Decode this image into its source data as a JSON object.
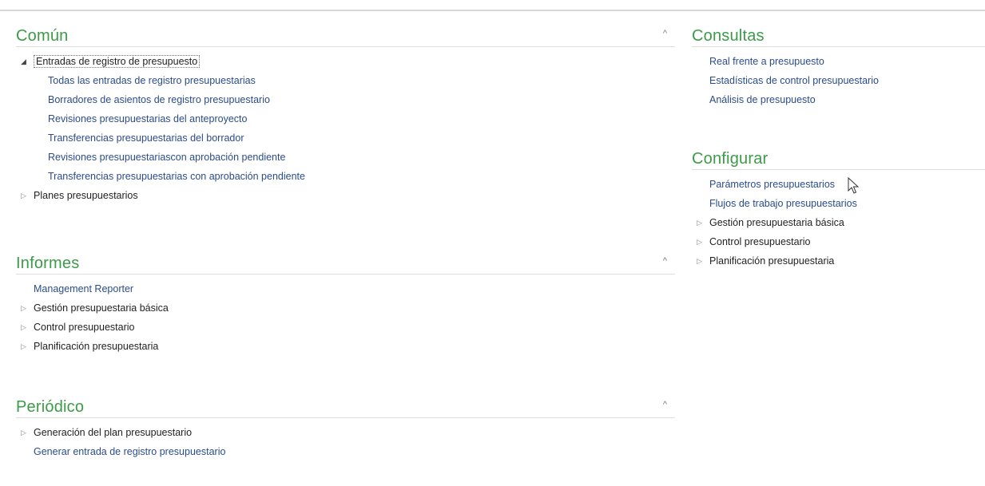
{
  "left_column": {
    "comun": {
      "title": "Común",
      "collapse_glyph": "^",
      "expanded_group": "Entradas de registro de presupuesto",
      "expanded_children": [
        "Todas las entradas de registro presupuestarias",
        "Borradores de asientos de registro presupuestario",
        "Revisiones presupuestarias del anteproyecto",
        "Transferencias presupuestarias del borrador",
        "Revisiones presupuestariascon aprobación pendiente",
        "Transferencias presupuestarias con aprobación pendiente"
      ],
      "collapsed_group": "Planes presupuestarios"
    },
    "informes": {
      "title": "Informes",
      "collapse_glyph": "^",
      "link": "Management Reporter",
      "groups": [
        "Gestión presupuestaria básica",
        "Control presupuestario",
        "Planificación presupuestaria"
      ]
    },
    "periodico": {
      "title": "Periódico",
      "collapse_glyph": "^",
      "group": "Generación del plan presupuestario",
      "link": "Generar entrada de registro presupuestario"
    }
  },
  "right_column": {
    "consultas": {
      "title": "Consultas",
      "links": [
        "Real frente a presupuesto",
        "Estadísticas de control presupuestario",
        "Análisis de presupuesto"
      ]
    },
    "configurar": {
      "title": "Configurar",
      "links": [
        "Parámetros presupuestarios",
        "Flujos de trabajo presupuestarios"
      ],
      "groups": [
        "Gestión presupuestaria básica",
        "Control presupuestario",
        "Planificación presupuestaria"
      ]
    }
  },
  "icons": {
    "expanded": "triangle-expanded-icon",
    "collapsed": "triangle-collapsed-icon",
    "collapse_section": "caret-up-icon",
    "cursor": "mouse-pointer-icon"
  },
  "colors": {
    "section_title": "#3b9b47",
    "link": "#2a4c8c",
    "text": "#1f1f1f",
    "divider": "#dedede"
  }
}
